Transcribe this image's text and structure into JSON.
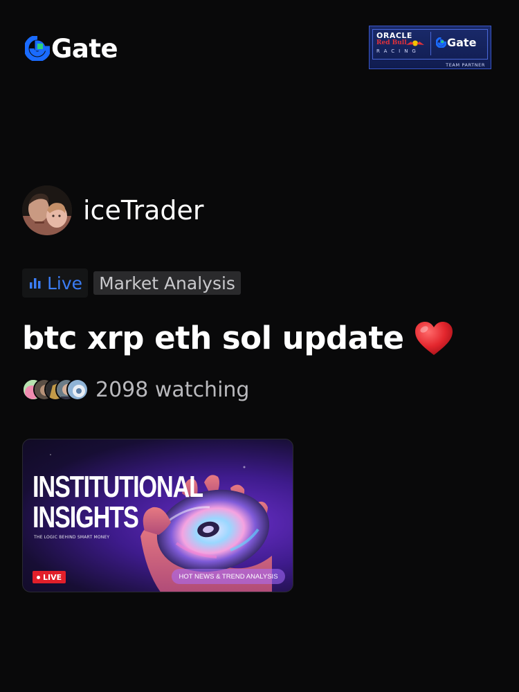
{
  "header": {
    "brand_name": "Gate",
    "brand_color": "#1a6bff",
    "partner_badge": {
      "line1": "ORACLE",
      "line2": "Red Bull",
      "line3": "RACING",
      "gate_text": "Gate",
      "footer": "TEAM PARTNER"
    }
  },
  "host": {
    "name": "iceTrader"
  },
  "tags": {
    "live_label": "Live",
    "category_label": "Market Analysis",
    "live_color": "#3b7df5"
  },
  "stream": {
    "title": "btc xrp eth sol update",
    "title_emoji_icon": "red-heart-icon",
    "watch_text": "2098 watching"
  },
  "thumbnail": {
    "headline_line1": "INSTITUTIONAL",
    "headline_line2": "INSIGHTS",
    "subline": "THE LOGIC BEHIND SMART MONEY",
    "live_badge": "LIVE",
    "pill_text": "HOT NEWS & TREND ANALYSIS"
  }
}
